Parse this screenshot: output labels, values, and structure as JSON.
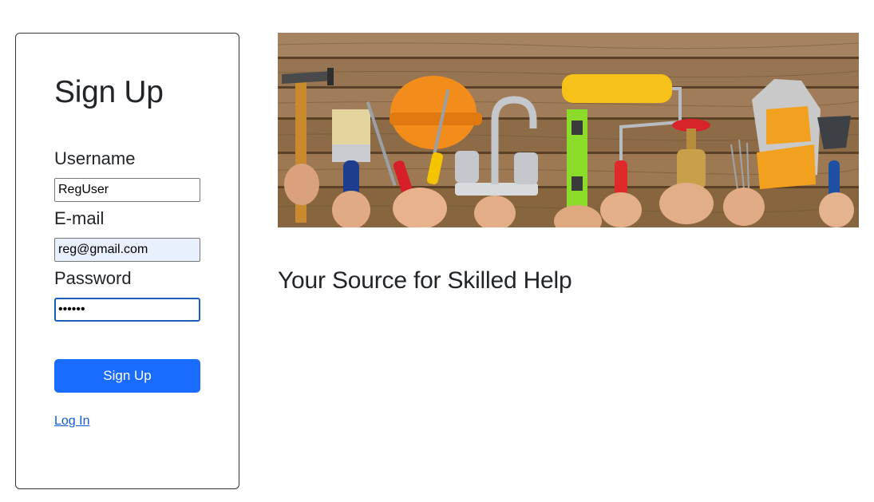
{
  "signup": {
    "title": "Sign Up",
    "username_label": "Username",
    "username_value": "RegUser",
    "email_label": "E-mail",
    "email_value": "reg@gmail.com",
    "password_label": "Password",
    "password_value": "••••••",
    "submit_label": "Sign Up",
    "login_link": "Log In"
  },
  "hero": {
    "tagline": "Your Source for Skilled Help"
  },
  "colors": {
    "primary": "#1a6bff",
    "link": "#0d5bd8",
    "autofill": "#e8f0fe",
    "wood": "#8b6a45"
  }
}
